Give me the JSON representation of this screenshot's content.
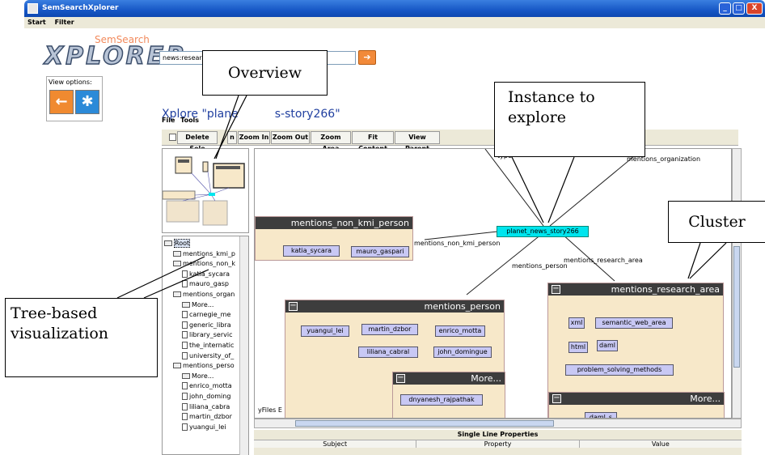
{
  "window": {
    "title": "SemSearchXplorer",
    "minimize": "_",
    "maximize": "□",
    "close": "X"
  },
  "menu": [
    "Start",
    "Filter"
  ],
  "logo": {
    "sub": "SemSearch",
    "main": "XPLORER"
  },
  "search": {
    "value": "news:research",
    "go": "➔"
  },
  "view_options": {
    "label": "View options:",
    "back": "←",
    "explore": "✱"
  },
  "xplore_title": {
    "prefix": "Xplore \"plane",
    "suffix": "s-story266\""
  },
  "inner_menu": [
    "File",
    "Tools"
  ],
  "toolbar": [
    "Delete Sele",
    "n",
    "Zoom In",
    "Zoom Out",
    "Zoom Area",
    "Fit Content",
    "View Parent"
  ],
  "tree": [
    {
      "icon": "folder",
      "label": "Root",
      "indent": 0
    },
    {
      "icon": "folder",
      "label": "mentions_kmi_p",
      "indent": 1
    },
    {
      "icon": "folder",
      "label": "mentions_non_k",
      "indent": 1
    },
    {
      "icon": "doc",
      "label": "katia_sycara",
      "indent": 2
    },
    {
      "icon": "doc",
      "label": "mauro_gasp",
      "indent": 2
    },
    {
      "icon": "folder",
      "label": "mentions_organ",
      "indent": 1
    },
    {
      "icon": "folder",
      "label": "More...",
      "indent": 2
    },
    {
      "icon": "doc",
      "label": "carnegie_me",
      "indent": 2
    },
    {
      "icon": "doc",
      "label": "generic_libra",
      "indent": 2
    },
    {
      "icon": "doc",
      "label": "library_servic",
      "indent": 2
    },
    {
      "icon": "doc",
      "label": "the_internatic",
      "indent": 2
    },
    {
      "icon": "doc",
      "label": "university_of_",
      "indent": 2
    },
    {
      "icon": "folder",
      "label": "mentions_perso",
      "indent": 1
    },
    {
      "icon": "folder",
      "label": "More...",
      "indent": 2
    },
    {
      "icon": "doc",
      "label": "enrico_motta",
      "indent": 2
    },
    {
      "icon": "doc",
      "label": "john_doming",
      "indent": 2
    },
    {
      "icon": "doc",
      "label": "liliana_cabra",
      "indent": 2
    },
    {
      "icon": "doc",
      "label": "martin_dzbor",
      "indent": 2
    },
    {
      "icon": "doc",
      "label": "yuangui_lei",
      "indent": 2
    }
  ],
  "graph": {
    "center": "planet_news_story266",
    "edges": [
      "type",
      "mentions_organization",
      "mentions_non_kmi_person",
      "mentions_person",
      "mentions_research_area"
    ],
    "clusters": {
      "non_kmi": {
        "title": "mentions_non_kmi_person",
        "nodes": [
          "katia_sycara",
          "mauro_gaspari"
        ]
      },
      "person": {
        "title": "mentions_person",
        "nodes": [
          "yuangui_lei",
          "martin_dzbor",
          "enrico_motta",
          "liliana_cabral",
          "john_domingue"
        ],
        "more": {
          "title": "More...",
          "nodes": [
            "dnyanesh_rajpathak"
          ]
        }
      },
      "research": {
        "title": "mentions_research_area",
        "nodes": [
          "xml",
          "semantic_web_area",
          "html",
          "daml",
          "problem_solving_methods"
        ],
        "more": {
          "title": "More...",
          "nodes": [
            "daml_s"
          ]
        }
      }
    },
    "watermark": "yFiles E"
  },
  "properties": {
    "title": "Single Line Properties",
    "columns": [
      "Subject",
      "Property",
      "Value"
    ]
  },
  "callouts": {
    "overview": "Overview",
    "instance_line1": "Instance to",
    "instance_line2": "explore",
    "cluster": "Cluster",
    "tree_line1": "Tree-based",
    "tree_line2": "visualization"
  }
}
